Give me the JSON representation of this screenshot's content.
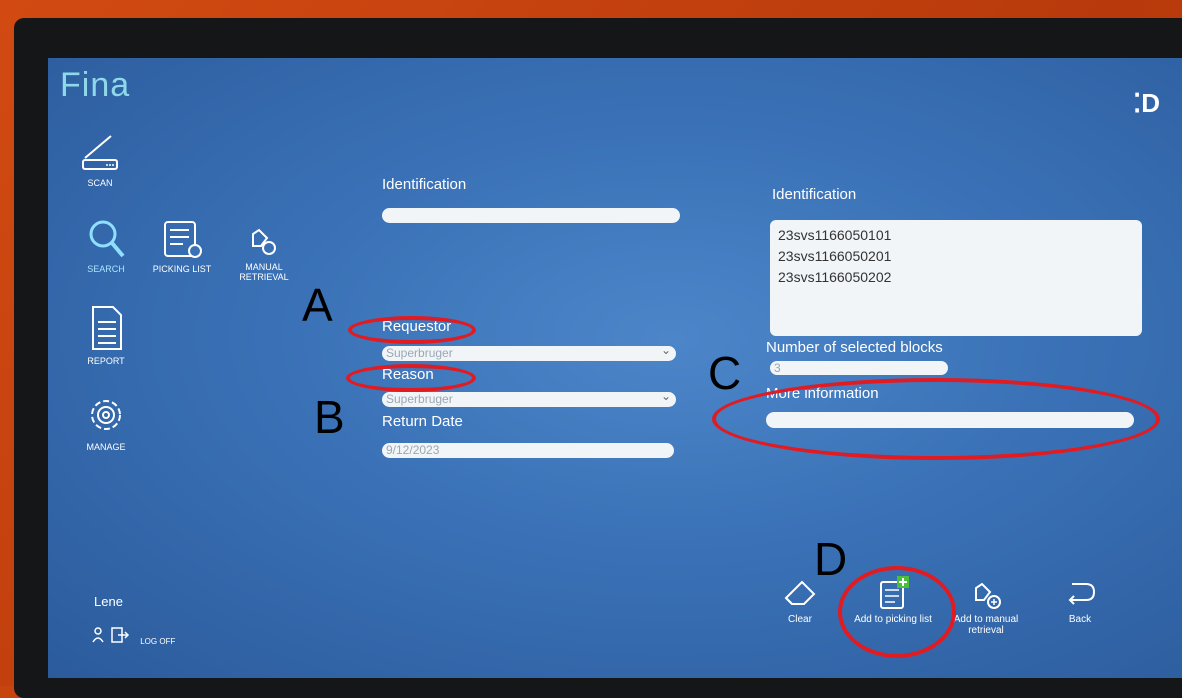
{
  "app": {
    "name": "Fina",
    "brand_mark": "ꞏD"
  },
  "sidebar": {
    "scan": "SCAN",
    "search": "SEARCH",
    "picking_list": "PICKING LIST",
    "manual_retrieval": "MANUAL\nRETRIEVAL",
    "report": "REPORT",
    "manage": "MANAGE",
    "user": "Lene",
    "logoff": "LOG OFF"
  },
  "form": {
    "identification_label": "Identification",
    "identification_value": "",
    "requestor_label": "Requestor",
    "requestor_value": "Superbruger",
    "reason_label": "Reason",
    "reason_value": "Superbruger",
    "return_date_label": "Return Date",
    "return_date_value": "9/12/2023"
  },
  "selection": {
    "identification_label": "Identification",
    "ids": [
      "23svs1166050101",
      "23svs1166050201",
      "23svs1166050202"
    ],
    "count_label": "Number of selected blocks",
    "count_value": "3",
    "more_info_label": "More information",
    "more_info_value": ""
  },
  "actions": {
    "clear": "Clear",
    "add_to_picking_list": "Add to picking list",
    "add_to_manual_retrieval": "Add to manual retrieval",
    "back": "Back"
  },
  "annotations": {
    "a": "A",
    "b": "B",
    "c": "C",
    "d": "D"
  },
  "colors": {
    "annotation_ring": "#e01b22",
    "screen_bg": "#3a71b6",
    "logo": "#8fd8ea"
  }
}
